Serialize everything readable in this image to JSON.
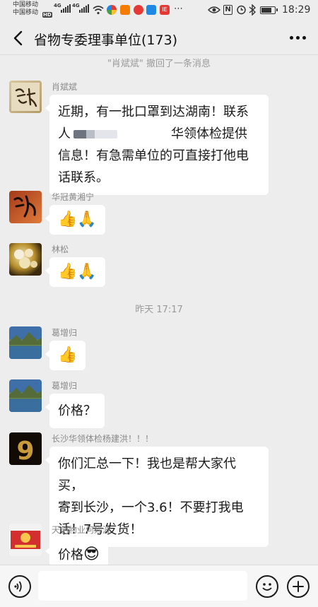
{
  "status_bar": {
    "carrier_1": "中国移动",
    "carrier_2": "中国移动",
    "network_1": "4G",
    "network_2": "4G",
    "hd_badge": "HD",
    "app_badge": "IE",
    "time": "18:29",
    "battery_level_percent": 80,
    "icons": [
      "signal-icon",
      "wifi-icon",
      "eye-icon",
      "nfc-icon",
      "alarm-icon",
      "bluetooth-icon",
      "battery-icon"
    ]
  },
  "header": {
    "title": "省物专委理事单位(173)",
    "back_icon": "chevron-left-icon",
    "more_icon": "more-dots-icon"
  },
  "system_notices": {
    "recall": "\"肖斌斌\" 撤回了一条消息",
    "time_divider": "昨天 17:17"
  },
  "messages": [
    {
      "sender": "肖斌斌",
      "text_line_1a": "近期，有一批口罩到达湖南！联系",
      "text_line_2a": "人",
      "text_line_2b": "华领体检提供",
      "text_line_3": "信息！有急需单位的可直接打他电",
      "text_line_4": "话联系。"
    },
    {
      "sender": "华冠黄湘宁",
      "emoji": "👍🙏"
    },
    {
      "sender": "林松",
      "emoji": "👍🙏"
    },
    {
      "sender": "葛增归",
      "emoji": "👍"
    },
    {
      "sender": "葛增归",
      "text": "价格？"
    },
    {
      "sender": "长沙华领体检杨建洪！！！",
      "text_line_1": "你们汇总一下！我也是帮大家代买，",
      "text_line_2": "寄到长沙，一个3.6！不要打我电",
      "text_line_3": "话！7号发货！"
    },
    {
      "sender": "天创物业何妙波",
      "text": "价格",
      "emoji": "😎"
    }
  ],
  "input_bar": {
    "voice_icon": "voice-icon",
    "emoji_icon": "emoji-icon",
    "plus_icon": "plus-icon",
    "input_value": ""
  },
  "colors": {
    "background": "#ededed",
    "bubble": "#ffffff",
    "sender_text": "#8a8a8a",
    "system_text": "#9a9a9a"
  }
}
